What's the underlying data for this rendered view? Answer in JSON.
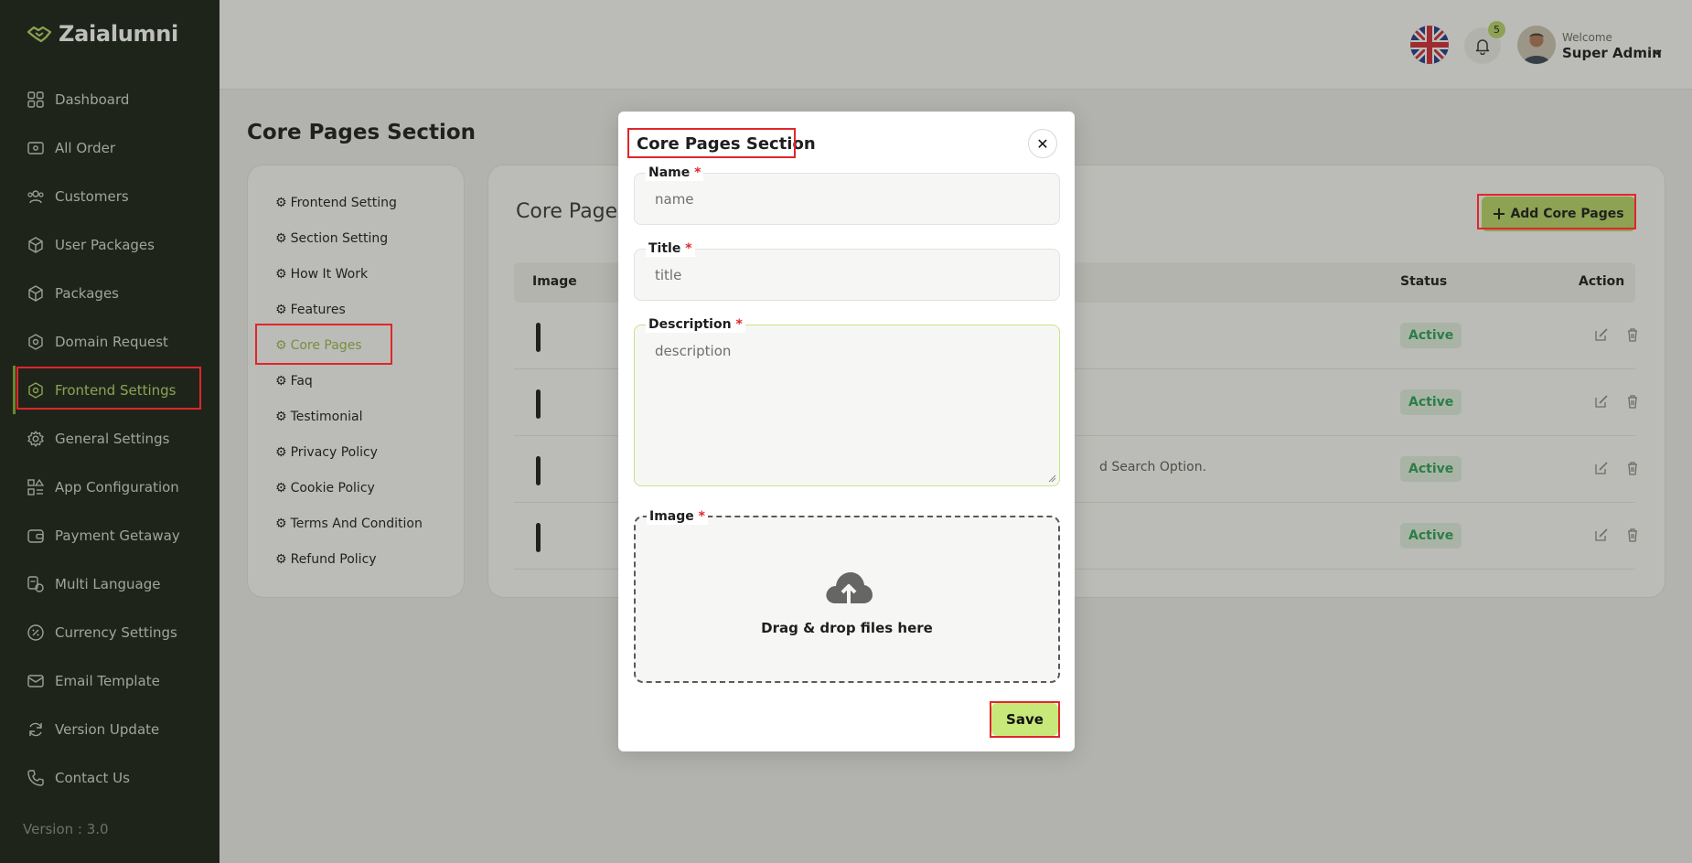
{
  "app": {
    "name": "Zaialumni",
    "version": "Version : 3.0"
  },
  "sidebar": {
    "items": [
      {
        "label": "Dashboard",
        "icon": "grid-icon"
      },
      {
        "label": "All Order",
        "icon": "order-icon"
      },
      {
        "label": "Customers",
        "icon": "users-icon"
      },
      {
        "label": "User Packages",
        "icon": "box-icon"
      },
      {
        "label": "Packages",
        "icon": "box-icon"
      },
      {
        "label": "Domain Request",
        "icon": "target-icon"
      },
      {
        "label": "Frontend Settings",
        "icon": "target-icon",
        "active": true
      },
      {
        "label": "General Settings",
        "icon": "gear-icon"
      },
      {
        "label": "App Configuration",
        "icon": "apps-icon"
      },
      {
        "label": "Payment Getaway",
        "icon": "wallet-icon"
      },
      {
        "label": "Multi Language",
        "icon": "translate-icon"
      },
      {
        "label": "Currency Settings",
        "icon": "percent-icon"
      },
      {
        "label": "Email Template",
        "icon": "mail-icon"
      },
      {
        "label": "Version Update",
        "icon": "refresh-icon"
      },
      {
        "label": "Contact Us",
        "icon": "phone-icon"
      }
    ]
  },
  "header": {
    "notification_count": "5",
    "welcome": "Welcome",
    "user_name": "Super Admin"
  },
  "page": {
    "title": "Core Pages Section",
    "submenu": [
      "Frontend Setting",
      "Section Setting",
      "How It Work",
      "Features",
      "Core Pages",
      "Faq",
      "Testimonial",
      "Privacy Policy",
      "Cookie Policy",
      "Terms And Condition",
      "Refund Policy"
    ],
    "submenu_active": "Core Pages"
  },
  "card": {
    "title": "Core Pages",
    "add_button": "Add Core Pages",
    "columns": {
      "image": "Image",
      "status": "Status",
      "action": "Action"
    },
    "rows": [
      {
        "desc": "",
        "status": "Active"
      },
      {
        "desc": "",
        "status": "Active"
      },
      {
        "desc": "d Search Option.",
        "status": "Active"
      },
      {
        "desc": "",
        "status": "Active"
      }
    ]
  },
  "modal": {
    "title": "Core Pages Section",
    "name_label": "Name",
    "name_placeholder": "name",
    "title_label": "Title",
    "title_placeholder": "title",
    "description_label": "Description",
    "description_placeholder": "description",
    "image_label": "Image",
    "required_mark": "*",
    "drop_text": "Drag & drop files here",
    "save_label": "Save",
    "close_glyph": "✕"
  },
  "colors": {
    "sidebar_bg": "#1c211a",
    "accent": "#b9d66a",
    "status_green": "#2ea356",
    "highlight_red": "#e0262b"
  }
}
